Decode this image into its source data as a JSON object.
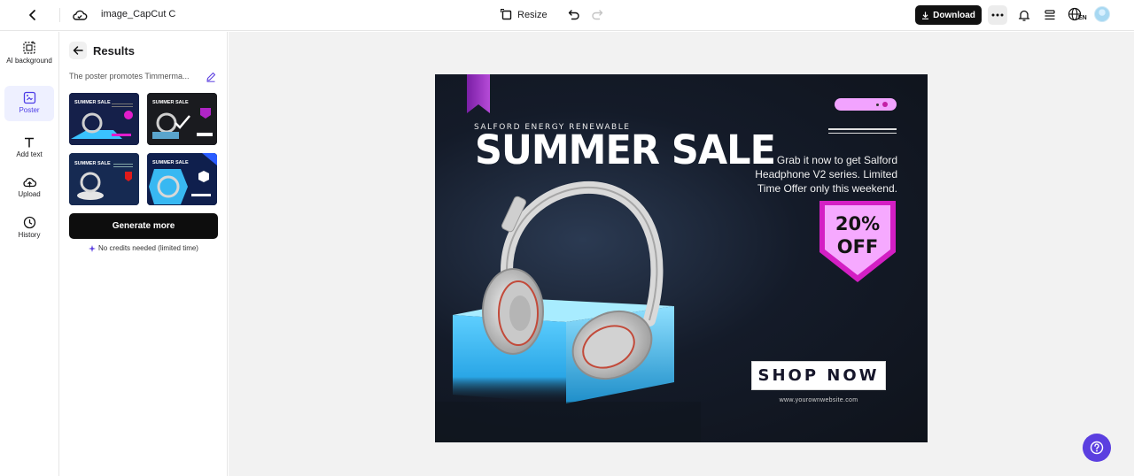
{
  "header": {
    "doc_title": "image_CapCut C",
    "resize_label": "Resize",
    "download_label": "Download",
    "language_code": "EN"
  },
  "rail": {
    "items": [
      {
        "label": "AI background",
        "icon": "ai-background-icon"
      },
      {
        "label": "Poster",
        "icon": "poster-icon",
        "active": true
      },
      {
        "label": "Add text",
        "icon": "text-icon"
      },
      {
        "label": "Upload",
        "icon": "upload-icon"
      },
      {
        "label": "History",
        "icon": "history-icon"
      }
    ]
  },
  "panel": {
    "title": "Results",
    "prompt": "The poster promotes Timmerma...",
    "generate_label": "Generate more",
    "credits_note": "No credits needed (limited time)",
    "thumbnail_caption": "SUMMER SALE"
  },
  "poster": {
    "company": "SALFORD ENERGY RENEWABLE",
    "headline": "SUMMER SALE",
    "description": "Grab it now to get Salford Headphone V2 series. Limited Time Offer only this weekend.",
    "discount_line1": "20%",
    "discount_line2": "OFF",
    "cta": "SHOP NOW",
    "url": "www.yourownwebsite.com"
  },
  "colors": {
    "accent": "#5b3fe0",
    "poster_bg": "#141b29",
    "badge_magenta": "#d41fc4",
    "badge_pink": "#f6a9ff",
    "cube_blue": "#4cc3f5"
  }
}
